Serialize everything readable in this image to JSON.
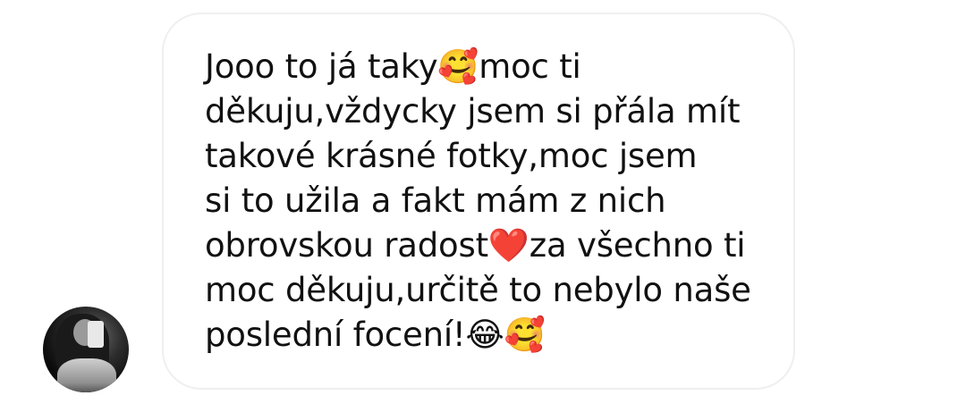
{
  "message": {
    "lines": [
      "Jooo to já taky🥰moc ti",
      "děkuju,vždycky jsem si přála mít",
      "takové krásné fotky,moc jsem",
      "si to užila a fakt mám z nich",
      "obrovskou radost❤️za všechno ti",
      "moc děkuju,určitě to nebylo naše",
      "poslední focení!😂🥰"
    ]
  },
  "avatar": {
    "icon": "user-avatar"
  },
  "colors": {
    "bubble_border": "#efefef",
    "text": "#111111",
    "background": "#ffffff"
  }
}
